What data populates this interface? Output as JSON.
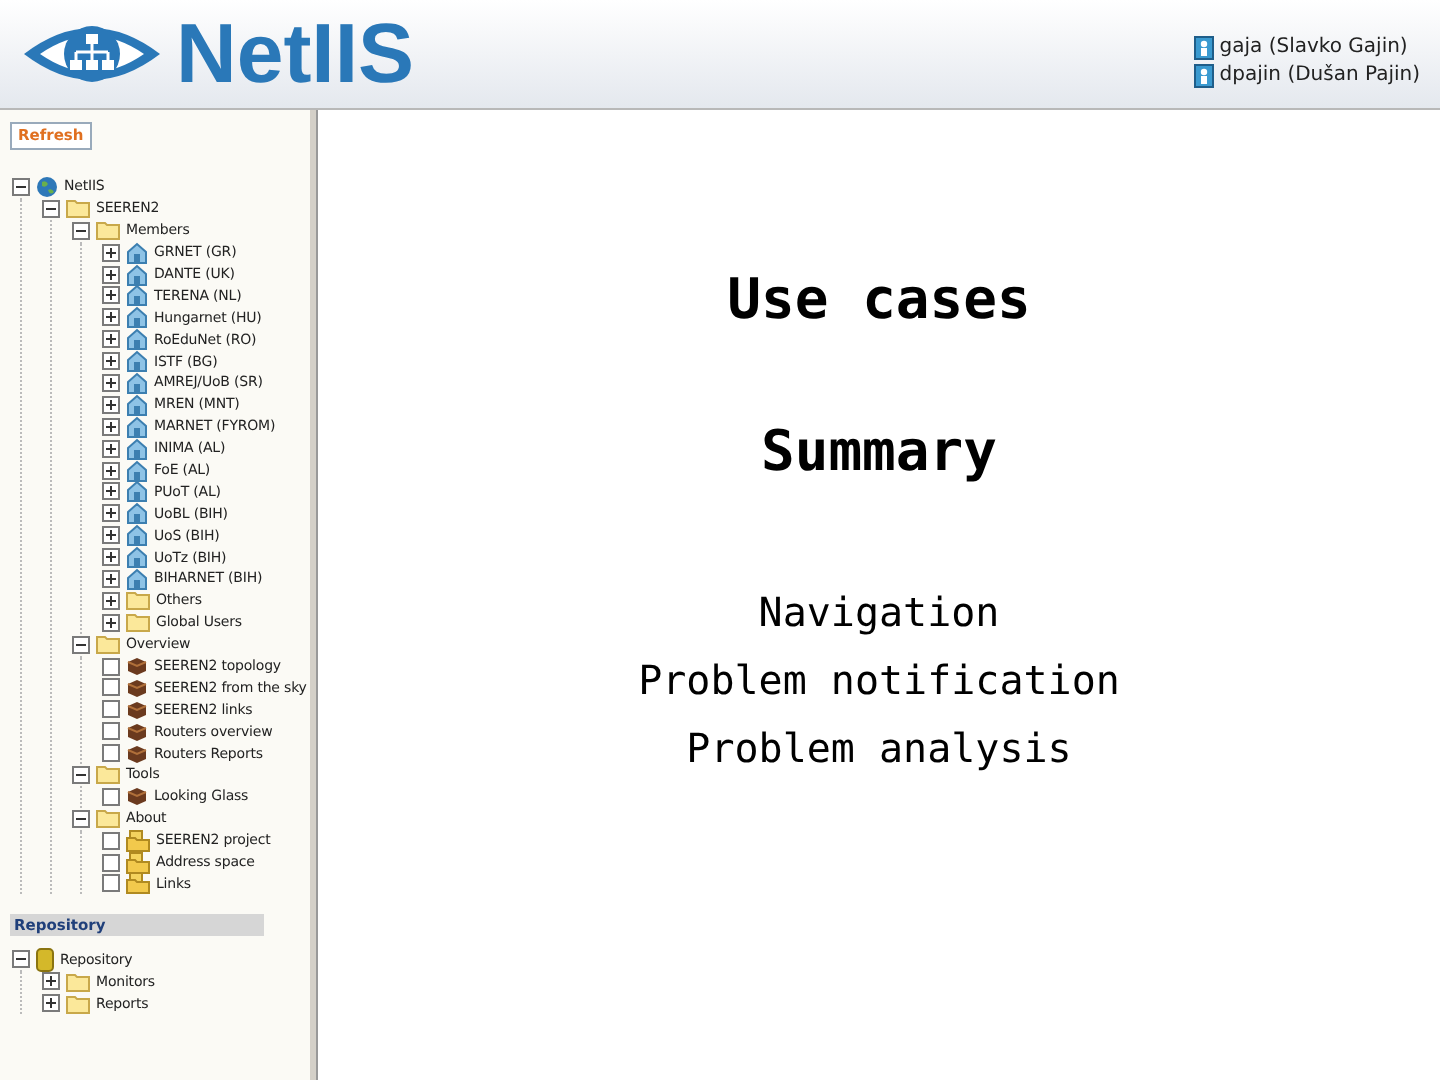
{
  "header": {
    "logo_text": "NetIIS",
    "users": [
      {
        "name": "gaja (Slavko Gajin)"
      },
      {
        "name": "dpajin (Dušan Pajin)"
      }
    ]
  },
  "sidebar": {
    "refresh_button": "Refresh",
    "tree": [
      {
        "label": "NetIIS",
        "kind": "globe",
        "expanded": true,
        "children": [
          {
            "label": "SEEREN2",
            "kind": "folder",
            "expanded": true,
            "children": [
              {
                "label": "Members",
                "kind": "folder",
                "expanded": true,
                "children": [
                  {
                    "label": "GRNET (GR)",
                    "kind": "house",
                    "expanded": false
                  },
                  {
                    "label": "DANTE (UK)",
                    "kind": "house",
                    "expanded": false
                  },
                  {
                    "label": "TERENA (NL)",
                    "kind": "house",
                    "expanded": false
                  },
                  {
                    "label": "Hungarnet (HU)",
                    "kind": "house",
                    "expanded": false
                  },
                  {
                    "label": "RoEduNet (RO)",
                    "kind": "house",
                    "expanded": false
                  },
                  {
                    "label": "ISTF (BG)",
                    "kind": "house",
                    "expanded": false
                  },
                  {
                    "label": "AMREJ/UoB (SR)",
                    "kind": "house",
                    "expanded": false
                  },
                  {
                    "label": "MREN (MNT)",
                    "kind": "house",
                    "expanded": false
                  },
                  {
                    "label": "MARNET (FYROM)",
                    "kind": "house",
                    "expanded": false
                  },
                  {
                    "label": "INIMA (AL)",
                    "kind": "house",
                    "expanded": false
                  },
                  {
                    "label": "FoE (AL)",
                    "kind": "house",
                    "expanded": false
                  },
                  {
                    "label": "PUoT (AL)",
                    "kind": "house",
                    "expanded": false
                  },
                  {
                    "label": "UoBL (BIH)",
                    "kind": "house",
                    "expanded": false
                  },
                  {
                    "label": "UoS (BIH)",
                    "kind": "house",
                    "expanded": false
                  },
                  {
                    "label": "UoTz (BIH)",
                    "kind": "house",
                    "expanded": false
                  },
                  {
                    "label": "BIHARNET (BIH)",
                    "kind": "house",
                    "expanded": false
                  },
                  {
                    "label": "Others",
                    "kind": "folder",
                    "expanded": false
                  },
                  {
                    "label": "Global Users",
                    "kind": "folder",
                    "expanded": false
                  }
                ]
              },
              {
                "label": "Overview",
                "kind": "folder",
                "expanded": true,
                "children": [
                  {
                    "label": "SEEREN2 topology",
                    "kind": "cube"
                  },
                  {
                    "label": "SEEREN2 from the sky",
                    "kind": "cube"
                  },
                  {
                    "label": "SEEREN2 links",
                    "kind": "cube"
                  },
                  {
                    "label": "Routers overview",
                    "kind": "cube"
                  },
                  {
                    "label": "Routers Reports",
                    "kind": "cube"
                  }
                ]
              },
              {
                "label": "Tools",
                "kind": "folder",
                "expanded": true,
                "children": [
                  {
                    "label": "Looking Glass",
                    "kind": "cube"
                  }
                ]
              },
              {
                "label": "About",
                "kind": "folder",
                "expanded": true,
                "children": [
                  {
                    "label": "SEEREN2 project",
                    "kind": "docfolder"
                  },
                  {
                    "label": "Address space",
                    "kind": "docfolder"
                  },
                  {
                    "label": "Links",
                    "kind": "docfolder"
                  }
                ]
              }
            ]
          }
        ]
      }
    ],
    "repository_heading": "Repository",
    "repository_tree": [
      {
        "label": "Repository",
        "kind": "database",
        "expanded": true,
        "children": [
          {
            "label": "Monitors",
            "kind": "folder",
            "expanded": false
          },
          {
            "label": "Reports",
            "kind": "folder",
            "expanded": false
          }
        ]
      }
    ]
  },
  "content": {
    "headings": [
      "Use cases",
      "Summary"
    ],
    "lines": [
      "Navigation",
      "Problem notification",
      "Problem analysis"
    ]
  }
}
